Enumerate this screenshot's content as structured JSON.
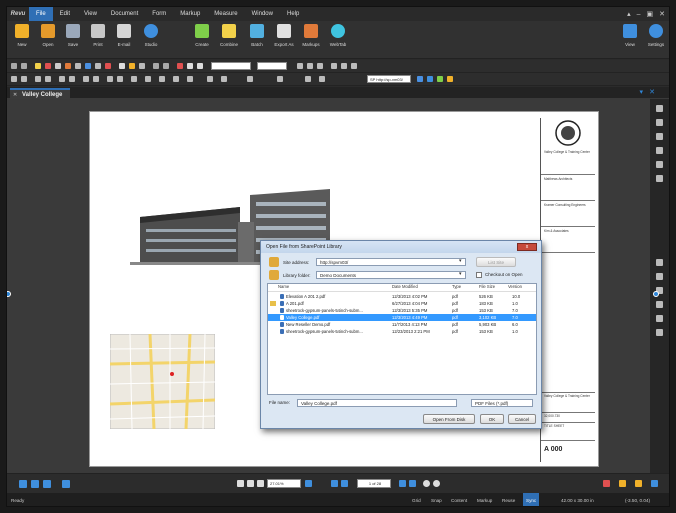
{
  "app": {
    "logo": "Revu"
  },
  "menu": [
    "File",
    "Edit",
    "View",
    "Document",
    "Form",
    "Markup",
    "Measure",
    "Window",
    "Help"
  ],
  "window_controls": [
    "▴",
    "‒",
    "▣",
    "✕"
  ],
  "toolbar": [
    {
      "label": "New",
      "icon": "new-doc-icon",
      "color": "#f1b12a"
    },
    {
      "label": "Open",
      "icon": "open-folder-icon",
      "color": "#e59a2b"
    },
    {
      "label": "Save",
      "icon": "save-icon",
      "color": "#9aa8ba"
    },
    {
      "label": "Print",
      "icon": "print-icon",
      "color": "#c8c8c8"
    },
    {
      "label": "E-mail",
      "icon": "email-icon",
      "color": "#d6d6d6"
    },
    {
      "label": "Studio",
      "icon": "studio-icon",
      "color": "#3f8fde"
    },
    {
      "label": "Create",
      "icon": "create-icon",
      "color": "#7fcf4a"
    },
    {
      "label": "Combine",
      "icon": "combine-icon",
      "color": "#f2d14a"
    },
    {
      "label": "Batch",
      "icon": "batch-icon",
      "color": "#52b0e0"
    },
    {
      "label": "Export As",
      "icon": "export-icon",
      "color": "#e0e0e0"
    },
    {
      "label": "Markups",
      "icon": "markups-icon",
      "color": "#e07a3a"
    },
    {
      "label": "WebTab",
      "icon": "webtab-icon",
      "color": "#3fc4e0"
    },
    {
      "label": "View",
      "icon": "view-icon",
      "color": "#3f8fde"
    },
    {
      "label": "Settings",
      "icon": "settings-icon",
      "color": "#3f8fde"
    }
  ],
  "strip_combo": "SP http://sp-vm03/",
  "tab": {
    "title": "Valley College"
  },
  "title_block": {
    "org": "Valley College & Training Center",
    "consultant1": "Matthews Architects",
    "consultant2": "Kramer Consulting Engineers",
    "consultant3": "Kim & Associates",
    "project_name": "Valley College & Training Center",
    "project_no": "32,000.730",
    "sheet_title": "TITLE SHEET",
    "sheet_no": "A 000"
  },
  "dialog": {
    "title": "Open File from SharePoint Library",
    "close": "x",
    "site_address_label": "Site address:",
    "site_address_value": "http://spvm03/",
    "list_sites_button": "List Site",
    "library_folder_label": "Library folder:",
    "library_folder_value": "Demo Documents",
    "checkout_label": "Checkout on Open",
    "columns": [
      "Name",
      "Date Modified",
      "Type",
      "File Size",
      "Version"
    ],
    "files": [
      {
        "name": "Elevation A 201 2.pdf",
        "date": "12/3/2013 4:02 PM",
        "type": "pdf",
        "size": "526 KB",
        "version": "10.0",
        "locked": false
      },
      {
        "name": "A 201.pdf",
        "date": "6/27/2013 4:04 PM",
        "type": "pdf",
        "size": "183 KB",
        "version": "1.0",
        "locked": true
      },
      {
        "name": "sheetrock-gypsum-panels-54inch-subm...",
        "date": "12/3/2013 5:35 PM",
        "type": "pdf",
        "size": "153 KB",
        "version": "7.0",
        "locked": false
      },
      {
        "name": "Valley College.pdf",
        "date": "12/3/2013 4:49 PM",
        "type": "pdf",
        "size": "3,102 KB",
        "version": "7.0",
        "locked": false,
        "selected": true
      },
      {
        "name": "New Reseller Demo.pdf",
        "date": "11/7/2013 4:13 PM",
        "type": "pdf",
        "size": "5,903 KB",
        "version": "6.0",
        "locked": false
      },
      {
        "name": "sheetrock-gypsum-panels-54inch-subm...",
        "date": "12/23/2013 2:21 PM",
        "type": "pdf",
        "size": "153 KB",
        "version": "1.0",
        "locked": false
      }
    ],
    "file_name_label": "File name:",
    "file_name_value": "Valley College.pdf",
    "file_type_value": "PDF Files (*.pdf)",
    "open_from_disk": "Open From Disk",
    "ok": "OK",
    "cancel": "Cancel"
  },
  "navbar": {
    "zoom": "27.01%",
    "page": "1 of 28"
  },
  "status": {
    "left": "Ready",
    "items": [
      "Grid",
      "Snap",
      "Content",
      "Markup",
      "Reuse",
      "Sync"
    ],
    "active": "Sync",
    "dimensions": "42.00 x 30.00 in",
    "coords": "(-3.50, 0.04)"
  }
}
